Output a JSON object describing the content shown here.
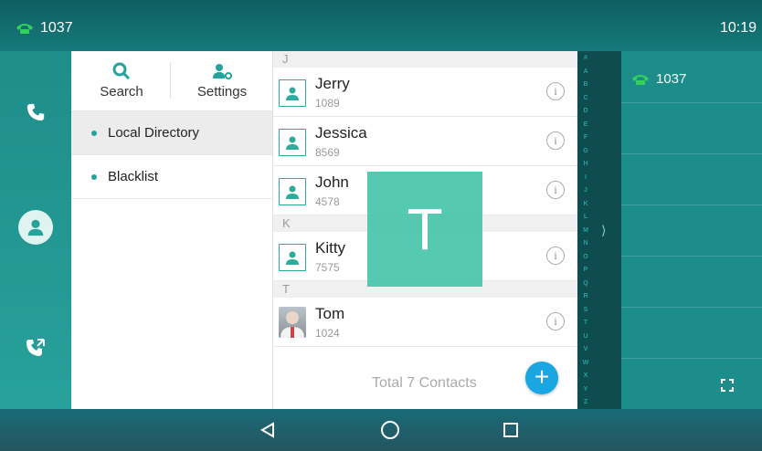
{
  "status": {
    "line": "1037",
    "time": "10:19"
  },
  "menu": {
    "search_label": "Search",
    "settings_label": "Settings",
    "items": [
      {
        "label": "Local Directory",
        "active": true
      },
      {
        "label": "Blacklist",
        "active": false
      }
    ]
  },
  "contacts": {
    "sections": [
      {
        "letter": "J",
        "entries": [
          {
            "name": "Jerry",
            "number": "1089"
          },
          {
            "name": "Jessica",
            "number": "8569"
          },
          {
            "name": "John",
            "number": "4578"
          }
        ]
      },
      {
        "letter": "K",
        "entries": [
          {
            "name": "Kitty",
            "number": "7575"
          }
        ]
      },
      {
        "letter": "T",
        "entries": [
          {
            "name": "Tom",
            "number": "1024"
          }
        ]
      }
    ],
    "total": "Total 7 Contacts",
    "index_letters": [
      "#",
      "A",
      "B",
      "C",
      "D",
      "E",
      "F",
      "G",
      "H",
      "I",
      "J",
      "K",
      "L",
      "M",
      "N",
      "O",
      "P",
      "Q",
      "R",
      "S",
      "T",
      "U",
      "V",
      "W",
      "X",
      "Y",
      "Z"
    ],
    "overlay_letter": "T"
  },
  "right_panel": {
    "line": "1037"
  },
  "colors": {
    "accent": "#27a19b",
    "add_button": "#1aa6e3",
    "overlay": "#42c4a8"
  }
}
